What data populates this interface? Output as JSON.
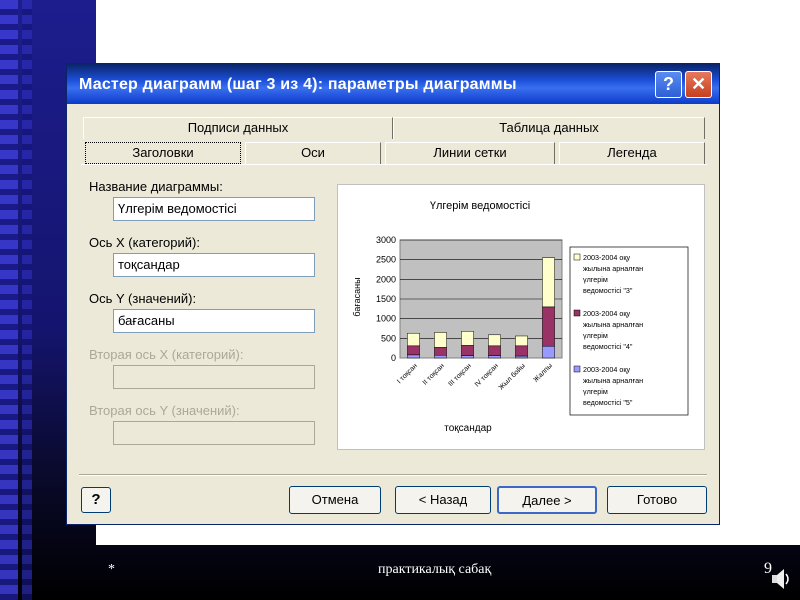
{
  "dialog": {
    "title": "Мастер диаграмм (шаг 3 из 4): параметры диаграммы",
    "help_glyph": "?",
    "close_glyph": "✕"
  },
  "tabs": [
    {
      "label": "Подписи данных",
      "active": false
    },
    {
      "label": "Таблица данных",
      "active": false
    },
    {
      "label": "Заголовки",
      "active": true
    },
    {
      "label": "Оси",
      "active": false
    },
    {
      "label": "Линии сетки",
      "active": false
    },
    {
      "label": "Легенда",
      "active": false
    }
  ],
  "fields": {
    "chart_title_label": "Название диаграммы:",
    "chart_title_value": "Үлгерім ведомостісі",
    "x_axis_label": "Ось X (категорий):",
    "x_axis_value": "тоқсандар",
    "y_axis_label": "Ось Y (значений):",
    "y_axis_value": "бағасаны",
    "x2_axis_label": "Вторая ось X (категорий):",
    "x2_axis_value": "",
    "y2_axis_label": "Вторая ось Y (значений):",
    "y2_axis_value": ""
  },
  "buttons": {
    "help": "?",
    "cancel": "Отмена",
    "back": "< Назад",
    "next": "Далее >",
    "finish": "Готово"
  },
  "footer": {
    "star": "*",
    "center": "практикалық сабақ",
    "page": "9"
  },
  "chart_data": {
    "type": "bar",
    "stacked": true,
    "title": "Үлгерім ведомостісі",
    "xlabel": "тоқсандар",
    "ylabel": "бағасаны",
    "ylim": [
      0,
      3000
    ],
    "yticks": [
      0,
      500,
      1000,
      1500,
      2000,
      2500,
      3000
    ],
    "categories": [
      "I тоқсан",
      "II тоқсан",
      "III тоқсан",
      "IV тоқсан",
      "Жыл бойы",
      "Жалпы"
    ],
    "series": [
      {
        "name": "2003-2004 оқу жылына арналған үлгерім ведомостісі \"5\"",
        "color": "#9999ff",
        "values": [
          80,
          70,
          60,
          60,
          50,
          300
        ]
      },
      {
        "name": "2003-2004 оқу жылына арналған үлгерім ведомостісі \"4\"",
        "color": "#993366",
        "values": [
          230,
          200,
          260,
          250,
          260,
          1000
        ]
      },
      {
        "name": "2003-2004 оқу жылына арналған үлгерім ведомостісі \"3\"",
        "color": "#ffffcc",
        "values": [
          320,
          380,
          360,
          280,
          250,
          1250
        ]
      }
    ],
    "legend_order": [
      2,
      1,
      0
    ],
    "legend_position": "right",
    "plot_background": "#c0c0c0"
  }
}
